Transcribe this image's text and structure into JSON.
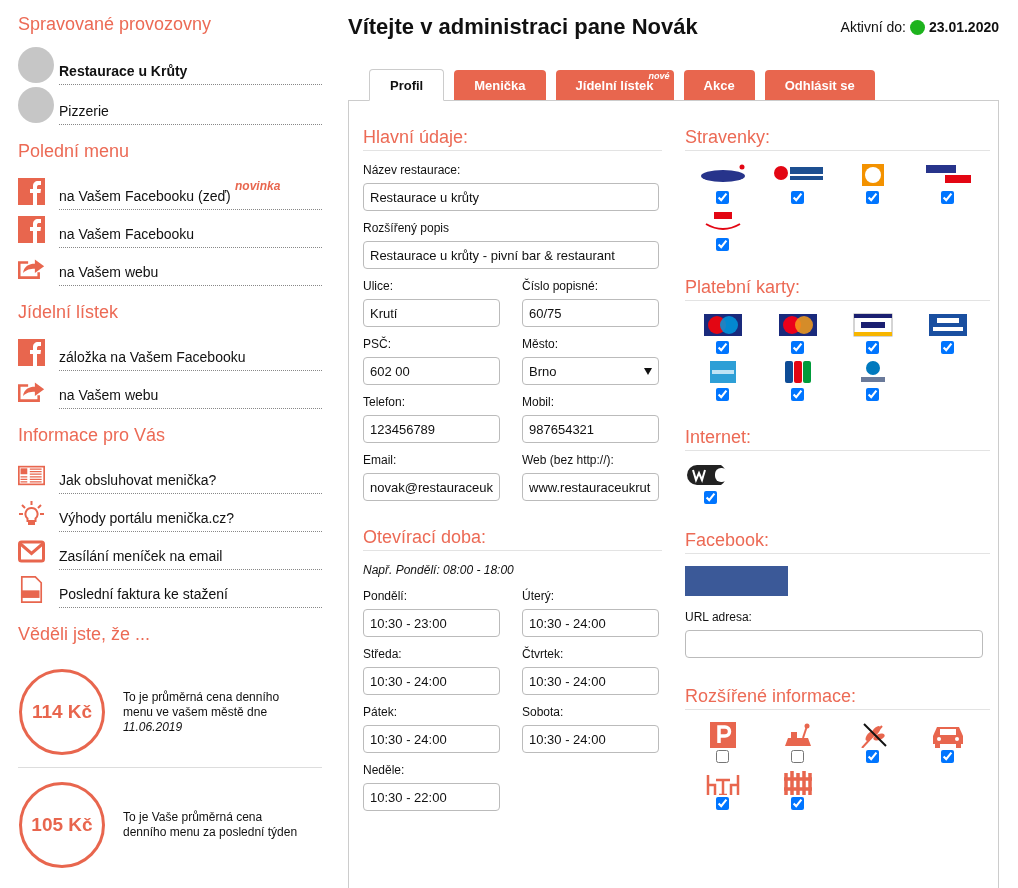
{
  "sidebar": {
    "sections": [
      {
        "title": "Spravované provozovny",
        "kind": "places",
        "items": [
          {
            "label": "Restaurace u Krůty",
            "selected": true
          },
          {
            "label": "Pizzerie",
            "selected": false
          }
        ]
      },
      {
        "title": "Polední menu",
        "kind": "links",
        "items": [
          {
            "label": "na Vašem Facebooku (zeď)",
            "kind": "facebook",
            "badge": "novinka"
          },
          {
            "label": "na Vašem Facebooku",
            "kind": "facebook"
          },
          {
            "label": "na Vašem webu",
            "kind": "share"
          }
        ]
      },
      {
        "title": "Jídelní lístek",
        "kind": "links",
        "items": [
          {
            "label": "záložka na Vašem Facebooku",
            "kind": "facebook"
          },
          {
            "label": "na Vašem webu",
            "kind": "share"
          }
        ]
      },
      {
        "title": "Informace pro Vás",
        "kind": "links",
        "items": [
          {
            "label": "Jak obsluhovat menička?",
            "kind": "guide"
          },
          {
            "label": "Výhody portálu menička.cz?",
            "kind": "bulb"
          },
          {
            "label": "Zasílání meníček na email",
            "kind": "mail"
          },
          {
            "label": "Poslední faktura ke stažení",
            "kind": "pdf"
          }
        ]
      }
    ],
    "facts": {
      "title": "Věděli jste, že ...",
      "items": [
        {
          "value": "114 Kč",
          "text": "To je průměrná cena denního menu ve vašem městě dne",
          "date": "11.06.2019"
        },
        {
          "value": "105 Kč",
          "text": "To je Vaše průměrná cena denního menu za poslední týden"
        }
      ]
    }
  },
  "header": {
    "title": "Vítejte v administraci pane Novák",
    "active_label": "Aktivní do:",
    "active": true,
    "active_date": "23.01.2020"
  },
  "tabs": [
    {
      "label": "Profil",
      "selected": true
    },
    {
      "label": "Menička",
      "selected": false
    },
    {
      "label": "Jídelní lístek",
      "selected": false,
      "badge": "nové"
    },
    {
      "label": "Akce",
      "selected": false
    },
    {
      "label": "Odhlásit se",
      "selected": false
    }
  ],
  "main_info": {
    "title": "Hlavní údaje:",
    "rows": [
      [
        {
          "label": "Název restaurace:",
          "value": "Restaurace u krůty",
          "kind": "text"
        }
      ],
      [
        {
          "label": "Rozšířený popis",
          "value": "Restaurace u krůty - pivní bar & restaurant",
          "kind": "text"
        }
      ],
      [
        {
          "label": "Ulice:",
          "value": "Krutí",
          "kind": "text"
        },
        {
          "label": "Číslo popisné:",
          "value": "60/75",
          "kind": "text"
        }
      ],
      [
        {
          "label": "PSČ:",
          "value": "602 00",
          "kind": "text"
        },
        {
          "label": "Město:",
          "value": "Brno",
          "kind": "select"
        }
      ],
      [
        {
          "label": "Telefon:",
          "value": "123456789",
          "kind": "text"
        },
        {
          "label": "Mobil:",
          "value": "987654321",
          "kind": "text"
        }
      ],
      [
        {
          "label": "Email:",
          "value": "novak@restauraceuk",
          "kind": "text"
        },
        {
          "label": "Web (bez http://):",
          "value": "www.restauraceukrut",
          "kind": "text"
        }
      ]
    ]
  },
  "hours": {
    "title": "Otevírací doba:",
    "hint": "Např. Pondělí: 08:00 - 18:00",
    "fields": [
      {
        "label": "Pondělí:",
        "value": "10:30 - 23:00"
      },
      {
        "label": "Úterý:",
        "value": "10:30 - 24:00"
      },
      {
        "label": "Středa:",
        "value": "10:30 - 24:00"
      },
      {
        "label": "Čtvrtek:",
        "value": "10:30 - 24:00"
      },
      {
        "label": "Pátek:",
        "value": "10:30 - 24:00"
      },
      {
        "label": "Sobota:",
        "value": "10:30 - 24:00"
      },
      {
        "label": "Neděle:",
        "value": "10:30 - 22:00"
      }
    ]
  },
  "vouchers": {
    "title": "Stravenky:",
    "items": [
      {
        "kind": "sodexo",
        "checked": true
      },
      {
        "kind": "ticket",
        "checked": true
      },
      {
        "kind": "cheque",
        "checked": true
      },
      {
        "kind": "gastro",
        "checked": true
      },
      {
        "kind": "nase",
        "checked": true
      }
    ]
  },
  "cards": {
    "title": "Platební karty:",
    "items": [
      {
        "kind": "maestro",
        "checked": true
      },
      {
        "kind": "mastercard",
        "checked": true
      },
      {
        "kind": "visa",
        "checked": true
      },
      {
        "kind": "electron",
        "checked": true
      },
      {
        "kind": "amex",
        "checked": true
      },
      {
        "kind": "jcb",
        "checked": true
      },
      {
        "kind": "diners",
        "checked": true
      }
    ]
  },
  "internet": {
    "title": "Internet:",
    "items": [
      {
        "kind": "wifi",
        "checked": true
      }
    ]
  },
  "facebook": {
    "title": "Facebook:",
    "url_label": "URL adresa:"
  },
  "extras": {
    "title": "Rozšířené informace:",
    "items": [
      {
        "kind": "parking",
        "checked": false
      },
      {
        "kind": "playground",
        "checked": false
      },
      {
        "kind": "gluten",
        "checked": true
      },
      {
        "kind": "car",
        "checked": true
      },
      {
        "kind": "terrace",
        "checked": true
      },
      {
        "kind": "garden",
        "checked": true
      }
    ]
  }
}
